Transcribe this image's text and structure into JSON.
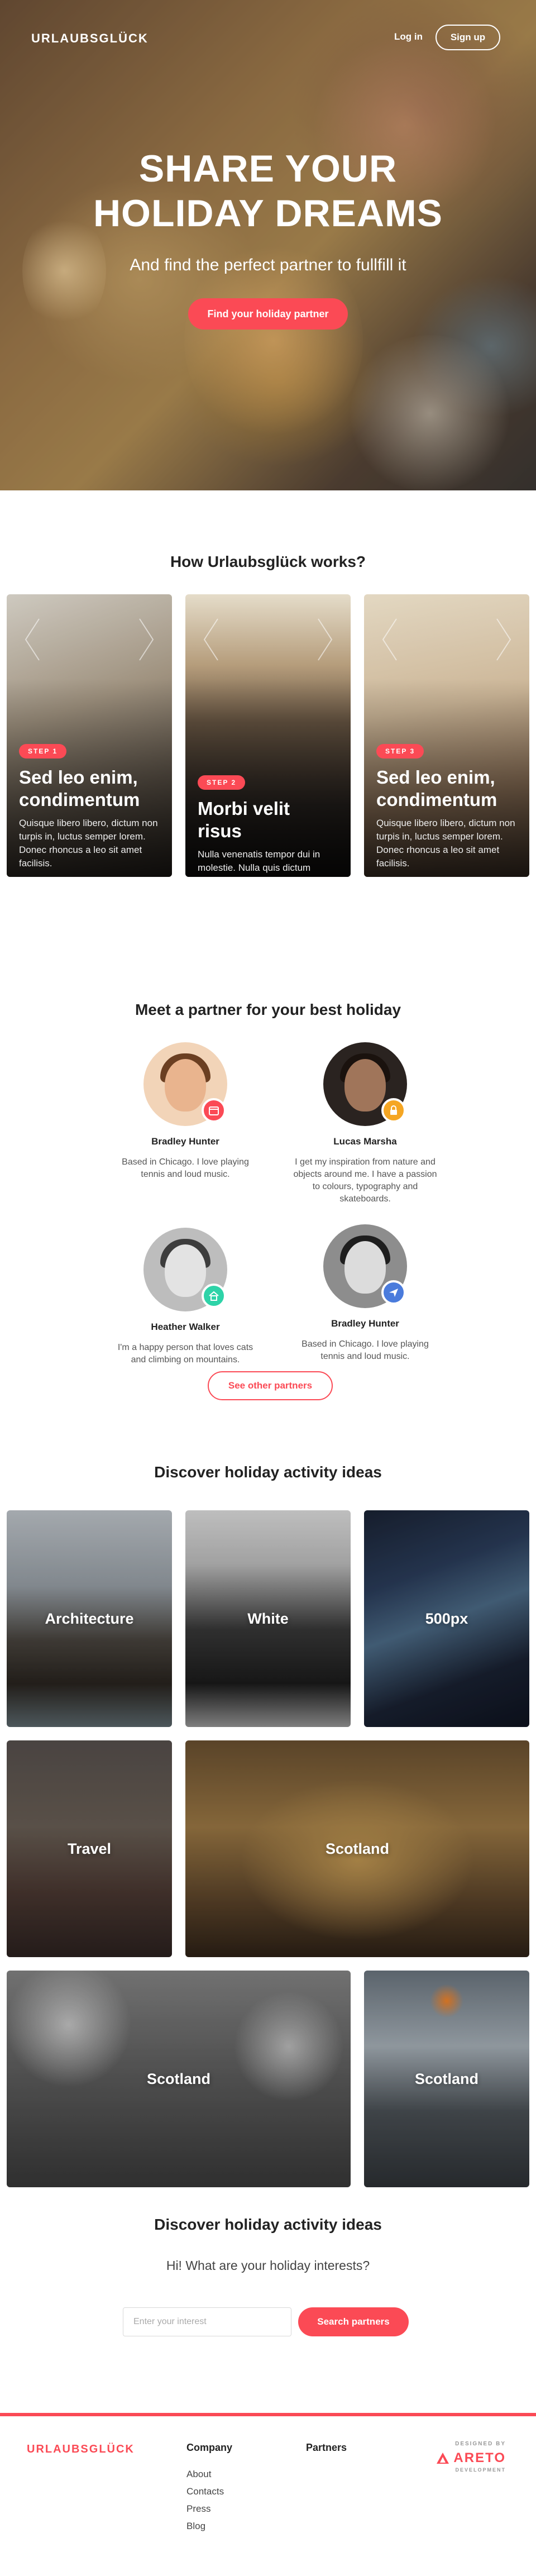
{
  "header": {
    "logo": "URLAUBSGLÜCK",
    "login_label": "Log in",
    "signup_label": "Sign up"
  },
  "hero": {
    "title": "SHARE YOUR HOLIDAY DREAMS",
    "subtitle": "And find the perfect partner to fullfill it",
    "cta_label": "Find your holiday partner"
  },
  "how_it_works": {
    "title": "How Urlaubsglück works?",
    "steps": [
      {
        "badge": "STEP 1",
        "title": "Sed leo enim, condimentum",
        "text": "Quisque libero libero, dictum non turpis in, luctus semper lorem. Donec rhoncus a leo sit amet facilisis."
      },
      {
        "badge": "STEP 2",
        "title": "Morbi velit risus",
        "text": "Nulla venenatis tempor dui in molestie. Nulla quis dictum purus, sit amet porttitor est."
      },
      {
        "badge": "STEP 3",
        "title": "Sed leo enim, condimentum",
        "text": "Quisque libero libero, dictum non turpis in, luctus semper lorem. Donec rhoncus a leo sit amet facilisis."
      }
    ]
  },
  "partners": {
    "title": "Meet a partner for your best holiday",
    "people": [
      {
        "name": "Bradley Hunter",
        "bio": "Based in Chicago. I love playing tennis and loud music.",
        "badge_icon": "calendar-icon",
        "badge_color": "#fb4a55"
      },
      {
        "name": "Lucas Marsha",
        "bio": "I get my inspiration from nature and objects around me. I have a passion to colours, typography and skateboards.",
        "badge_icon": "lock-icon",
        "badge_color": "#f5a623"
      },
      {
        "name": "Heather Walker",
        "bio": "I'm a happy person that loves cats and climbing on mountains.",
        "badge_icon": "home-icon",
        "badge_color": "#2ed3a8"
      },
      {
        "name": "Bradley Hunter",
        "bio": "Based in Chicago. I love playing tennis and loud music.",
        "badge_icon": "send-icon",
        "badge_color": "#4a7bdc"
      }
    ],
    "see_other_label": "See other partners"
  },
  "activities": {
    "title": "Discover holiday activity ideas",
    "tiles": [
      {
        "label": "Architecture"
      },
      {
        "label": "White"
      },
      {
        "label": "500px"
      },
      {
        "label": "Travel"
      },
      {
        "label": "Scotland"
      },
      {
        "label": "Scotland"
      },
      {
        "label": "Scotland"
      }
    ]
  },
  "interests": {
    "title": "Discover holiday activity ideas",
    "subtitle": "Hi! What are your holiday interests?",
    "input_placeholder": "Enter your interest",
    "search_label": "Search partners"
  },
  "footer": {
    "logo": "URLAUBSGLÜCK",
    "company_title": "Company",
    "company_links": [
      "About",
      "Contacts",
      "Press",
      "Blog"
    ],
    "partners_title": "Partners",
    "designed_by": "DESIGNED BY",
    "designer_name": "ARETO",
    "designer_sub": "DEVELOPMENT"
  },
  "colors": {
    "accent": "#fb4a55",
    "text_dark": "#222222"
  }
}
